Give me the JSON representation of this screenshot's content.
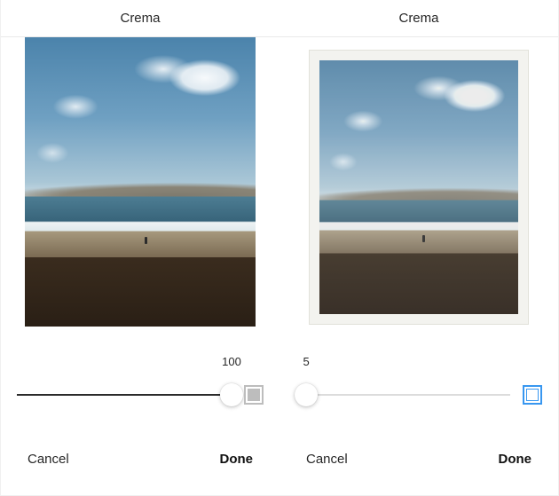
{
  "panels": [
    {
      "filter_name": "Crema",
      "intensity": 100,
      "intensity_label": "100",
      "frame_enabled": false,
      "cancel_label": "Cancel",
      "done_label": "Done"
    },
    {
      "filter_name": "Crema",
      "intensity": 5,
      "intensity_label": "5",
      "frame_enabled": true,
      "cancel_label": "Cancel",
      "done_label": "Done"
    }
  ]
}
